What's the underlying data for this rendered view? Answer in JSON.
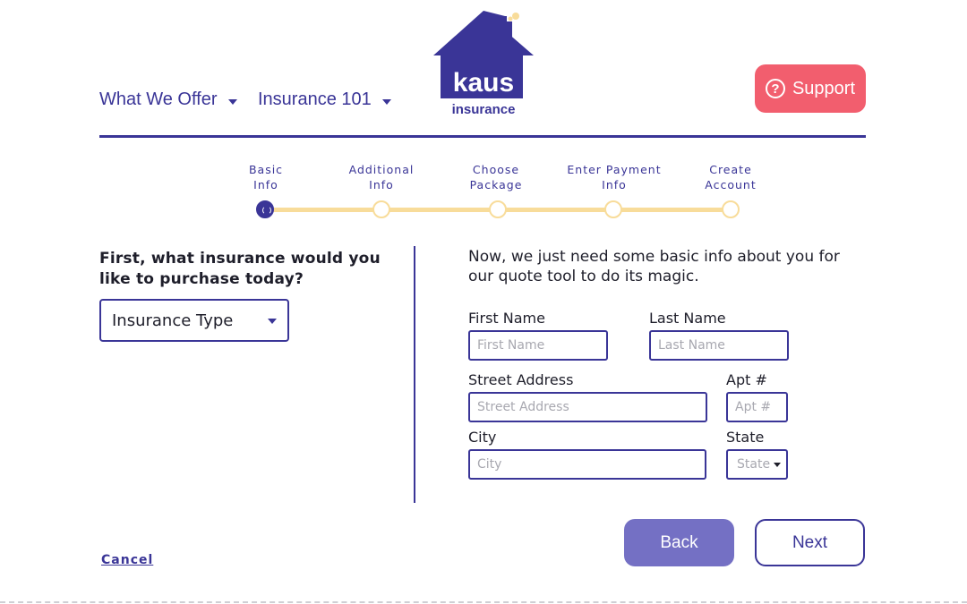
{
  "header": {
    "nav": [
      {
        "label": "What We Offer"
      },
      {
        "label": "Insurance 101"
      }
    ],
    "logo": {
      "name": "kaus",
      "sub": "insurance",
      "icon": "house-logo-icon"
    },
    "support_label": "Support",
    "support_icon": "question-circle-icon"
  },
  "steps": [
    {
      "line1": "Basic",
      "line2": "Info",
      "state": "active"
    },
    {
      "line1": "Additional",
      "line2": "Info",
      "state": "pending"
    },
    {
      "line1": "Choose",
      "line2": "Package",
      "state": "pending"
    },
    {
      "line1": "Enter Payment",
      "line2": "Info",
      "state": "pending"
    },
    {
      "line1": "Create",
      "line2": "Account",
      "state": "pending"
    }
  ],
  "left": {
    "question": "First, what insurance would you like to purchase today?",
    "select_value": "Insurance Type"
  },
  "right": {
    "intro": "Now, we just need some basic info about you for our quote tool to do its magic.",
    "fields": {
      "first_name": {
        "label": "First Name",
        "placeholder": "First Name"
      },
      "last_name": {
        "label": "Last Name",
        "placeholder": "Last Name"
      },
      "street": {
        "label": "Street Address",
        "placeholder": "Street Address"
      },
      "apt": {
        "label": "Apt #",
        "placeholder": "Apt #"
      },
      "city": {
        "label": "City",
        "placeholder": "City"
      },
      "state": {
        "label": "State",
        "value": "State"
      }
    }
  },
  "actions": {
    "back_label": "Back",
    "next_label": "Next",
    "cancel_label": "Cancel"
  },
  "colors": {
    "brand": "#3a3597",
    "support": "#f25e6e",
    "back": "#7470c4",
    "track": "#f8dc9a"
  }
}
